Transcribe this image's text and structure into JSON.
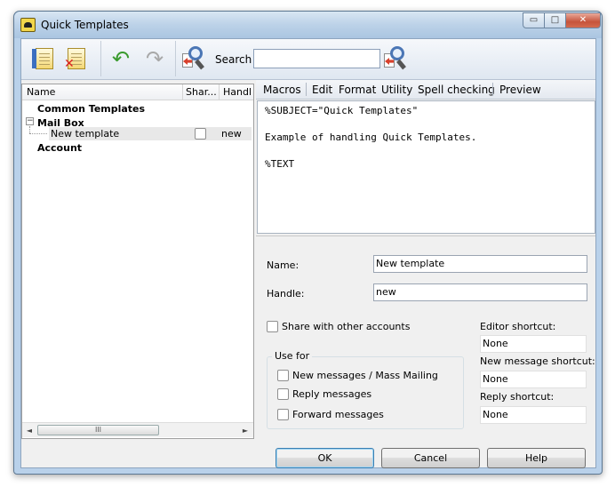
{
  "window": {
    "title": "Quick Templates",
    "controls": {
      "minimize": "▭",
      "maximize": "□",
      "close": "✕"
    }
  },
  "toolbar": {
    "search_label": "Search",
    "search_value": "",
    "icons": [
      "new-template-icon",
      "delete-template-icon",
      "undo-icon",
      "redo-icon",
      "find-icon",
      "search-go-icon"
    ]
  },
  "tree": {
    "columns": {
      "name": "Name",
      "shared": "Shar...",
      "handle": "Handl"
    },
    "nodes": {
      "common": "Common Templates",
      "mailbox": "Mail Box",
      "expander": "−",
      "new_template": {
        "name": "New template",
        "handle": "new"
      },
      "account": "Account"
    },
    "scroll_grip": "III",
    "scroll_left": "◄",
    "scroll_right": "►"
  },
  "menu": {
    "macros": "Macros",
    "edit": "Edit",
    "format": "Format",
    "utility": "Utility",
    "spell": "Spell checking",
    "preview": "Preview"
  },
  "editor": {
    "lines": [
      "%SUBJECT=\"Quick Templates\"",
      "Example of handling Quick Templates.",
      "%TEXT"
    ]
  },
  "props": {
    "name_label": "Name:",
    "name_value": "New template",
    "handle_label": "Handle:",
    "handle_value": "new",
    "share_label": "Share with other accounts",
    "use_for_title": "Use for",
    "use_new": "New messages / Mass Mailing",
    "use_reply": "Reply messages",
    "use_forward": "Forward messages",
    "editor_shortcut_label": "Editor shortcut:",
    "editor_shortcut_value": "None",
    "newmsg_shortcut_label": "New message shortcut:",
    "newmsg_shortcut_value": "None",
    "reply_shortcut_label": "Reply shortcut:",
    "reply_shortcut_value": "None"
  },
  "buttons": {
    "ok": "OK",
    "cancel": "Cancel",
    "help": "Help"
  }
}
